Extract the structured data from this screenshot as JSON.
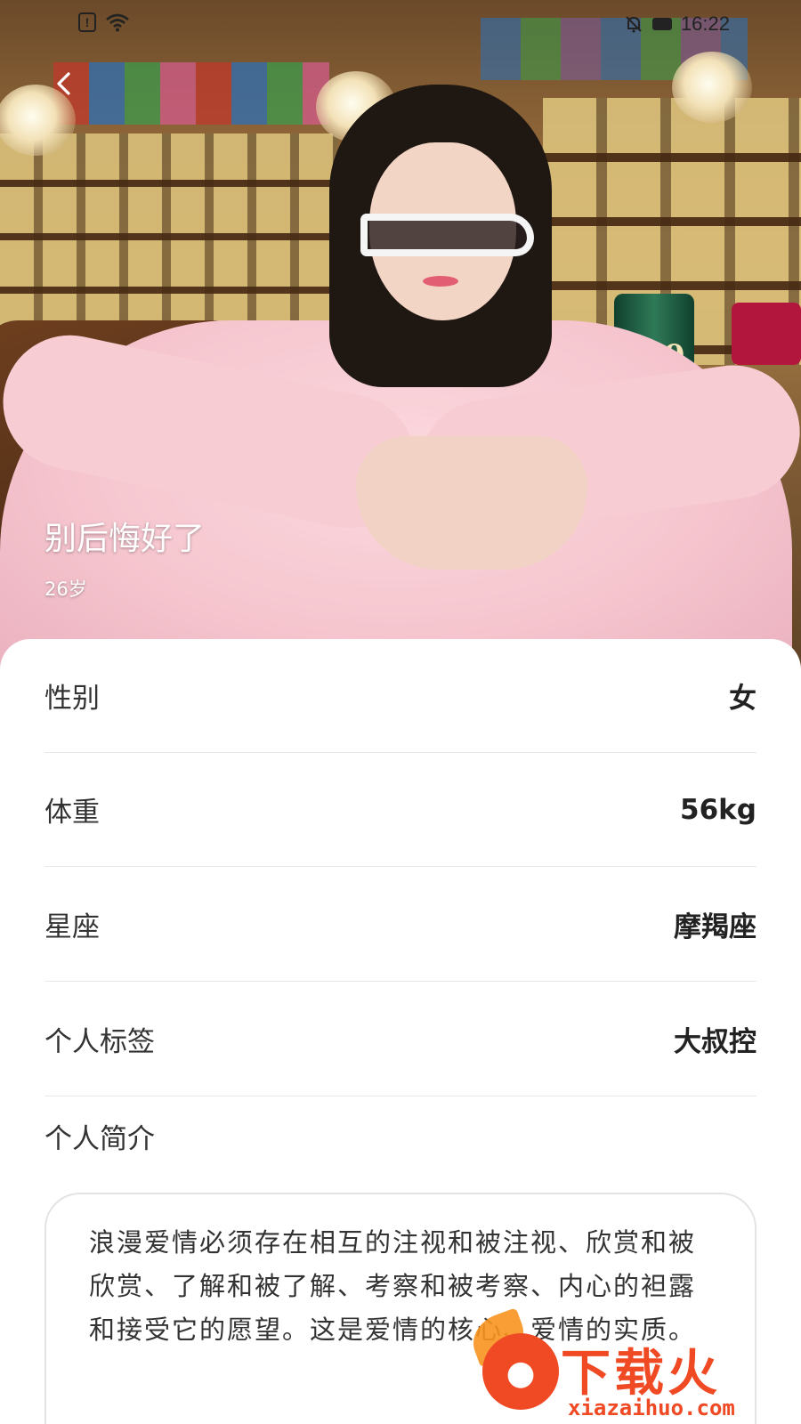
{
  "status_bar": {
    "alert_glyph": "!",
    "time": "16:22"
  },
  "profile": {
    "name": "别后悔好了",
    "age": "26岁"
  },
  "details": {
    "gender": {
      "label": "性别",
      "value": "女"
    },
    "weight": {
      "label": "体重",
      "value": "56kg"
    },
    "zodiac": {
      "label": "星座",
      "value": "摩羯座"
    },
    "tags": {
      "label": "个人标签",
      "value": "大叔控"
    }
  },
  "intro": {
    "label": "个人简介",
    "text": "浪漫爱情必须存在相互的注视和被注视、欣赏和被欣赏、了解和被了解、考察和被考察、内心的袒露和接受它的愿望。这是爱情的核心、爱情的实质。"
  },
  "photo": {
    "tin_label": "10"
  },
  "watermark": {
    "title": "下载火",
    "url": "xiazaihuo.com"
  },
  "icons": {
    "back": "chevron-left-icon",
    "wifi": "wifi-icon",
    "bell_off": "bell-off-icon",
    "battery": "battery-icon"
  }
}
